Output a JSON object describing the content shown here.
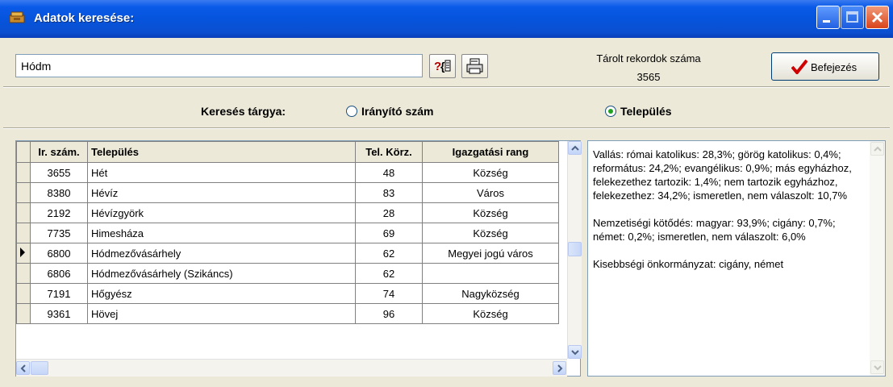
{
  "window": {
    "title": "Adatok keresése:",
    "title_color": "#0a5ae8"
  },
  "toolbar": {
    "search_value": "Hódm",
    "help_icon": "help-question-icon",
    "print_icon": "printer-icon",
    "record_count_label": "Tárolt rekordok száma",
    "record_count": "3565",
    "finish_label": "Befejezés",
    "finish_icon": "checkmark-icon"
  },
  "search_subject": {
    "label": "Keresés tárgya:",
    "options": [
      {
        "label": "Irányító szám",
        "selected": false
      },
      {
        "label": "Település",
        "selected": true
      }
    ]
  },
  "table": {
    "headers": [
      "Ir. szám.",
      "Település",
      "Tel. Körz.",
      "Igazgatási rang"
    ],
    "rows": [
      {
        "zip": "3655",
        "name": "Hét",
        "area": "48",
        "rank": "Község",
        "current": false
      },
      {
        "zip": "8380",
        "name": "Hévíz",
        "area": "83",
        "rank": "Város",
        "current": false
      },
      {
        "zip": "2192",
        "name": "Hévízgyörk",
        "area": "28",
        "rank": "Község",
        "current": false
      },
      {
        "zip": "7735",
        "name": "Himesháza",
        "area": "69",
        "rank": "Község",
        "current": false
      },
      {
        "zip": "6800",
        "name": "Hódmezővásárhely",
        "area": "62",
        "rank": "Megyei jogú város",
        "current": true
      },
      {
        "zip": "6806",
        "name": "Hódmezővásárhely (Szikáncs)",
        "area": "62",
        "rank": "",
        "current": false
      },
      {
        "zip": "7191",
        "name": "Hőgyész",
        "area": "74",
        "rank": "Nagyközség",
        "current": false
      },
      {
        "zip": "9361",
        "name": "Hövej",
        "area": "96",
        "rank": "Község",
        "current": false
      }
    ]
  },
  "details": {
    "text": "Vallás: római katolikus: 28,3%; görög katolikus: 0,4%; református: 24,2%; evangélikus: 0,9%; más egyházhoz, felekezethez tartozik: 1,4%; nem tartozik egyházhoz, felekezethez: 34,2%; ismeretlen, nem válaszolt: 10,7%\n\nNemzetiségi kötődés: magyar: 93,9%; cigány: 0,7%; német: 0,2%; ismeretlen, nem válaszolt: 6,0%\n\nKisebbségi önkormányzat: cigány, német"
  }
}
